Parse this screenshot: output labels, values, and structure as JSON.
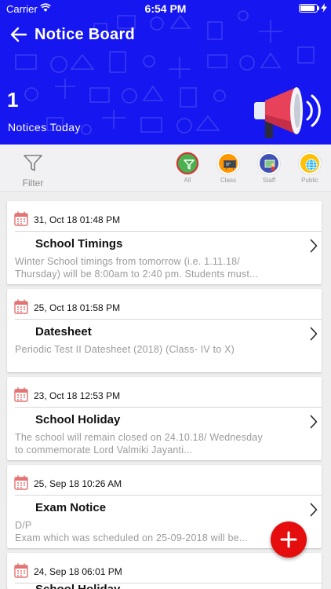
{
  "status_bar": {
    "carrier": "Carrier",
    "time": "6:54 PM",
    "battery_level": 0.9
  },
  "header": {
    "title": "Notice Board",
    "count": "1",
    "count_label": "Notices Today"
  },
  "filter_bar": {
    "filter_label": "Filter",
    "categories": [
      {
        "label": "All",
        "color": "#4caf50",
        "ring": "#d32f2f",
        "selected": true
      },
      {
        "label": "Class",
        "color": "#ff9800"
      },
      {
        "label": "Staff",
        "color": "#3f51b5"
      },
      {
        "label": "Public",
        "color": "#ffc107"
      }
    ]
  },
  "notices": [
    {
      "date": "31, Oct 18 01:48 PM",
      "title": "School Timings",
      "lines": [
        "Winter School timings from tomorrow (i.e. 1.11.18/",
        "Thursday) will be 8:00am to 2:40 pm. Students must..."
      ]
    },
    {
      "date": "25, Oct 18 01:58 PM",
      "title": "Datesheet",
      "lines": [
        "Periodic Test II Datesheet (2018) (Class- IV to X)"
      ]
    },
    {
      "date": "23, Oct 18 12:53 PM",
      "title": "School Holiday",
      "lines": [
        "The school will remain closed on 24.10.18/ Wednesday",
        "to commemorate Lord Valmiki Jayanti..."
      ]
    },
    {
      "date": "25, Sep 18 10:26 AM",
      "title": "Exam Notice",
      "lines": [
        "D/P",
        "Exam which was scheduled on 25-09-2018 will be..."
      ]
    },
    {
      "date": "24, Sep 18 06:01 PM",
      "title": "School Holiday",
      "lines": []
    }
  ],
  "colors": {
    "header_bg": "#1616f0",
    "fab": "#e50d0d",
    "calendar": "#e57373"
  }
}
